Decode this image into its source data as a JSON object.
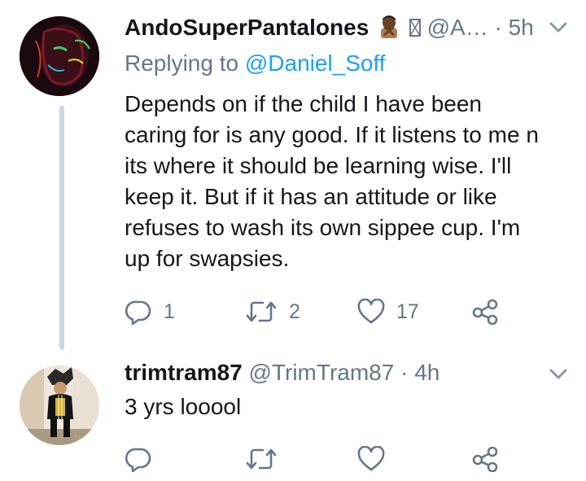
{
  "tweets": [
    {
      "name": "AndoSuperPantalones",
      "handle": "@A…",
      "time": "· 5h",
      "replying_prefix": "Replying to ",
      "replying_handle": "@Daniel_Soff",
      "text_lines": [
        "Depends on if the child I have been",
        "caring for is any good. If it listens to me n",
        "its where it should be learning wise. I'll",
        "keep it. But if it has an attitude or like",
        "refuses to wash its own sippee cup. I'm",
        "up for swapsies."
      ],
      "replies": "1",
      "retweets": "2",
      "likes": "17",
      "icons": [
        "man-gesturing-no-emoji",
        "unknown-glyph-emoji"
      ]
    },
    {
      "name": "trimtram87",
      "handle": "@TrimTram87",
      "time": "· 4h",
      "text_lines": [
        "3 yrs looool"
      ],
      "replies": "",
      "retweets": "",
      "likes": ""
    }
  ],
  "colors": {
    "muted": "#657786",
    "link": "#1da1f2",
    "thread": "#cdd6dd"
  }
}
